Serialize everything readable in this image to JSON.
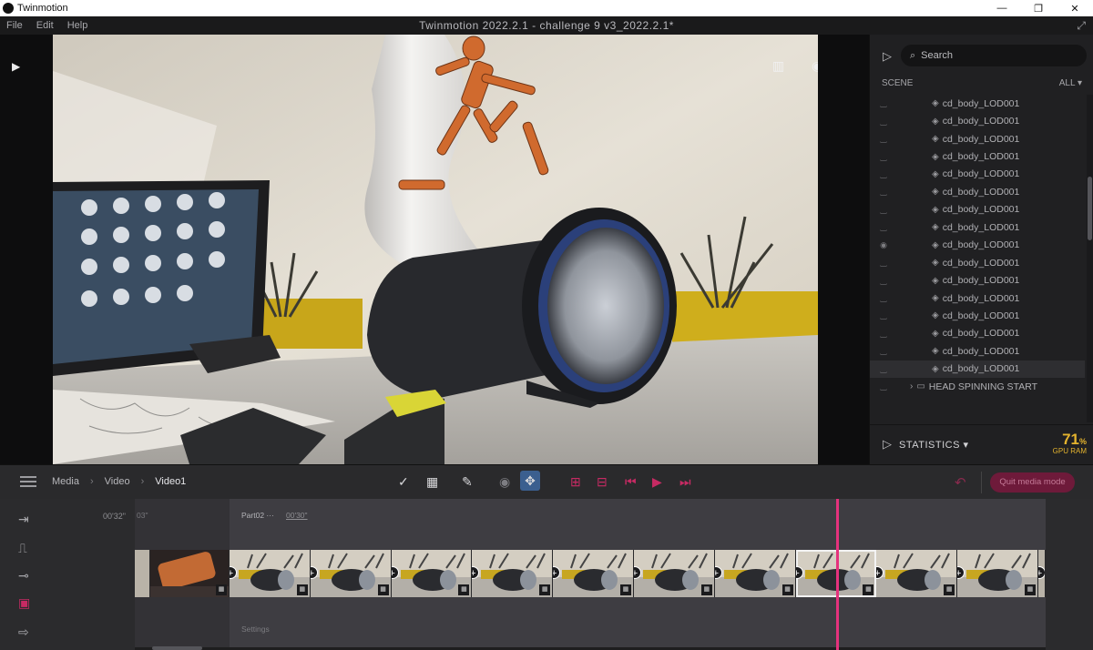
{
  "os": {
    "app_name": "Twinmotion",
    "controls": [
      "—",
      "❐",
      "✕"
    ]
  },
  "menu": {
    "items": [
      "File",
      "Edit",
      "Help"
    ],
    "document_title": "Twinmotion 2022.2.1 - challenge 9 v3_2022.2.1*"
  },
  "search": {
    "placeholder": "Search"
  },
  "scene": {
    "header": "SCENE",
    "filter": "ALL",
    "items": [
      {
        "label": "cd_body_LOD001",
        "visible": false,
        "type": "object"
      },
      {
        "label": "cd_body_LOD001",
        "visible": false,
        "type": "object"
      },
      {
        "label": "cd_body_LOD001",
        "visible": false,
        "type": "object"
      },
      {
        "label": "cd_body_LOD001",
        "visible": false,
        "type": "object"
      },
      {
        "label": "cd_body_LOD001",
        "visible": false,
        "type": "object"
      },
      {
        "label": "cd_body_LOD001",
        "visible": false,
        "type": "object"
      },
      {
        "label": "cd_body_LOD001",
        "visible": false,
        "type": "object"
      },
      {
        "label": "cd_body_LOD001",
        "visible": false,
        "type": "object"
      },
      {
        "label": "cd_body_LOD001",
        "visible": true,
        "type": "object"
      },
      {
        "label": "cd_body_LOD001",
        "visible": false,
        "type": "object"
      },
      {
        "label": "cd_body_LOD001",
        "visible": false,
        "type": "object"
      },
      {
        "label": "cd_body_LOD001",
        "visible": false,
        "type": "object"
      },
      {
        "label": "cd_body_LOD001",
        "visible": false,
        "type": "object"
      },
      {
        "label": "cd_body_LOD001",
        "visible": false,
        "type": "object"
      },
      {
        "label": "cd_body_LOD001",
        "visible": false,
        "type": "object"
      },
      {
        "label": "cd_body_LOD001",
        "visible": false,
        "type": "object",
        "selected": true
      },
      {
        "label": "HEAD SPINNING START",
        "visible": false,
        "type": "folder"
      }
    ]
  },
  "statistics": {
    "label": "STATISTICS",
    "gpu_value": "71",
    "gpu_unit": "%",
    "gpu_label": "GPU RAM",
    "accent": "#e4b32e"
  },
  "timeline_bar": {
    "breadcrumb": [
      "Media",
      "Video",
      "Video1"
    ],
    "quit_label": "Quit media mode",
    "accent": "#c62a63"
  },
  "timeline": {
    "time_left": "00'32\"",
    "first_clip_time": "03\"",
    "part_label": "Part02",
    "part_dots": "···",
    "part_time": "00'30\"",
    "settings_label": "Settings",
    "playhead_color": "#e5327d"
  }
}
